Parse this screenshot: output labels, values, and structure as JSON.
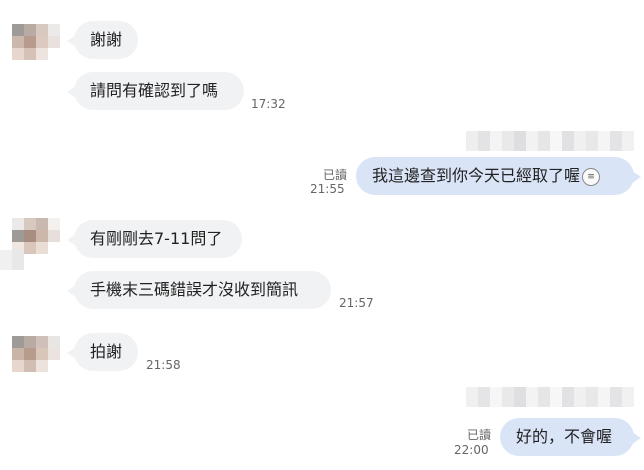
{
  "messages": {
    "m1": "謝謝",
    "m2": "請問有確認到了嗎",
    "m2_time": "17:32",
    "m3": "我這邊查到你今天已經取了喔",
    "m3_read": "已讀",
    "m3_time": "21:55",
    "m3_emoji": "grimacing-face-icon",
    "m4": "有剛剛去7-11問了",
    "m5": "手機末三碼錯誤才沒收到簡訊",
    "m5_time": "21:57",
    "m6": "拍謝",
    "m6_time": "21:58",
    "m7": "好的，不會喔",
    "m7_read": "已讀",
    "m7_time": "22:00"
  },
  "colors": {
    "incoming_bubble": "#f1f2f4",
    "outgoing_bubble": "#d9e4f7",
    "meta_text": "#666666"
  }
}
